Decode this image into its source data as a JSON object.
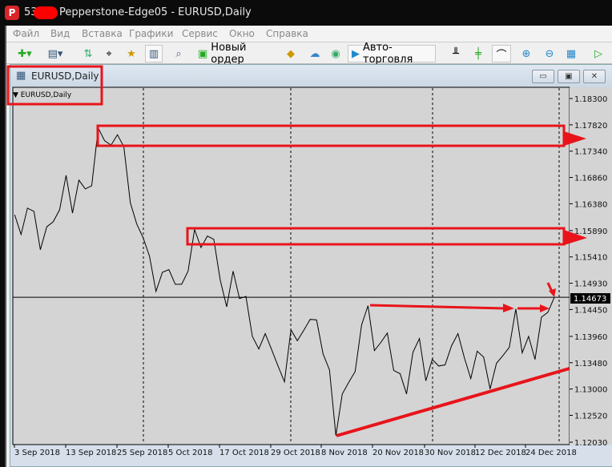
{
  "window": {
    "title_prefix": "53",
    "title": "Pepperstone-Edge05 - EURUSD,Daily",
    "logo": "P"
  },
  "menu": [
    "Файл",
    "Вид",
    "Вставка",
    "Графики",
    "Сервис",
    "Окно",
    "Справка"
  ],
  "toolbar": {
    "new_order": "Новый ордер",
    "autotrading": "Авто-торговля"
  },
  "chart_window": {
    "title": "EURUSD,Daily",
    "symbol_label": "EURUSD,Daily",
    "current_price": "1.14673"
  },
  "colors": {
    "annotation": "#e8141a",
    "chart_bg": "#d4d4d4"
  },
  "chart_data": {
    "type": "line",
    "title": "EURUSD,Daily",
    "ylim": [
      1.1203,
      1.183
    ],
    "y_ticks": [
      "1.18300",
      "1.17820",
      "1.17340",
      "1.16860",
      "1.16380",
      "1.15890",
      "1.15410",
      "1.14930",
      "1.14450",
      "1.13960",
      "1.13480",
      "1.13000",
      "1.12520",
      "1.12030"
    ],
    "x_ticks": [
      "3 Sep 2018",
      "13 Sep 2018",
      "25 Sep 2018",
      "5 Oct 2018",
      "17 Oct 2018",
      "29 Oct 2018",
      "8 Nov 2018",
      "20 Nov 2018",
      "30 Nov 2018",
      "12 Dec 2018",
      "24 Dec 2018"
    ],
    "current_price": 1.14673,
    "close": [
      1.1618,
      1.1582,
      1.163,
      1.1624,
      1.1554,
      1.1596,
      1.1605,
      1.1627,
      1.169,
      1.1621,
      1.1681,
      1.1665,
      1.1671,
      1.1776,
      1.1753,
      1.1745,
      1.1764,
      1.1742,
      1.164,
      1.1601,
      1.1576,
      1.1542,
      1.1478,
      1.1513,
      1.1518,
      1.1491,
      1.1491,
      1.1515,
      1.1591,
      1.1558,
      1.1579,
      1.1573,
      1.1499,
      1.145,
      1.1515,
      1.1465,
      1.1469,
      1.1396,
      1.1373,
      1.1401,
      1.1372,
      1.1342,
      1.1313,
      1.1408,
      1.1388,
      1.1407,
      1.1427,
      1.1426,
      1.1364,
      1.1335,
      1.1215,
      1.1291,
      1.1312,
      1.1332,
      1.1417,
      1.1452,
      1.137,
      1.1385,
      1.1402,
      1.1334,
      1.1328,
      1.1291,
      1.1367,
      1.1392,
      1.1315,
      1.1354,
      1.1342,
      1.1344,
      1.1379,
      1.1401,
      1.1357,
      1.1319,
      1.1369,
      1.1358,
      1.13,
      1.1347,
      1.1361,
      1.1376,
      1.1446,
      1.1366,
      1.1396,
      1.1354,
      1.1431,
      1.144,
      1.14673
    ]
  }
}
